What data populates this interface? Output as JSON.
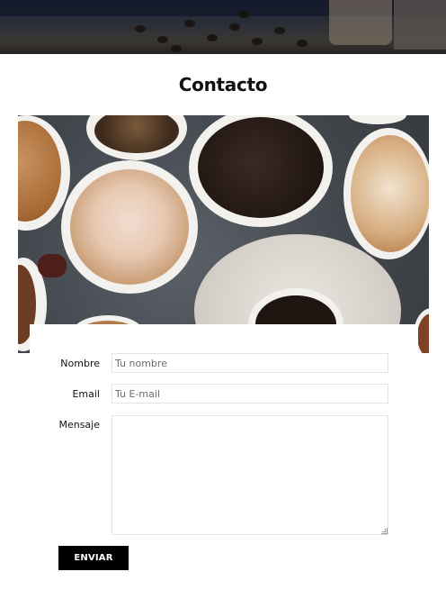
{
  "page": {
    "title": "Contacto"
  },
  "form": {
    "name_label": "Nombre",
    "name_placeholder": "Tu nombre",
    "email_label": "Email",
    "email_placeholder": "Tu E-mail",
    "message_label": "Mensaje",
    "submit_label": "ENVIAR"
  },
  "colors": {
    "button_bg": "#000000",
    "button_text": "#ffffff",
    "field_border": "#e4e4e4"
  }
}
